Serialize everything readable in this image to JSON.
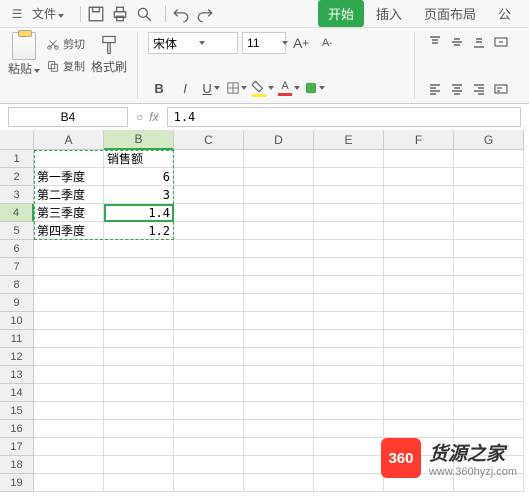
{
  "menubar": {
    "file": "文件",
    "tabs": {
      "start": "开始",
      "insert": "插入",
      "layout": "页面布局",
      "formula": "公"
    }
  },
  "ribbon": {
    "paste": "粘贴",
    "cut": "剪切",
    "copy": "复制",
    "format_painter": "格式刷",
    "font_name": "宋体",
    "font_size": "11"
  },
  "namebox": "B4",
  "formula": "1.4",
  "columns": [
    "A",
    "B",
    "C",
    "D",
    "E",
    "F",
    "G"
  ],
  "rows": [
    "1",
    "2",
    "3",
    "4",
    "5",
    "6",
    "7",
    "8",
    "9",
    "10",
    "11",
    "12",
    "13",
    "14",
    "15",
    "16",
    "17",
    "18",
    "19"
  ],
  "sheet": {
    "B1": "销售额",
    "A2": "第一季度",
    "B2": "6",
    "A3": "第二季度",
    "B3": "3",
    "A4": "第三季度",
    "B4": "1.4",
    "A5": "第四季度",
    "B5": "1.2"
  },
  "chart_data": {
    "type": "table",
    "title": "销售额",
    "categories": [
      "第一季度",
      "第二季度",
      "第三季度",
      "第四季度"
    ],
    "values": [
      6,
      3,
      1.4,
      1.2
    ]
  },
  "watermark": {
    "badge": "360",
    "title": "货源之家",
    "url": "www.360hyzj.com"
  }
}
